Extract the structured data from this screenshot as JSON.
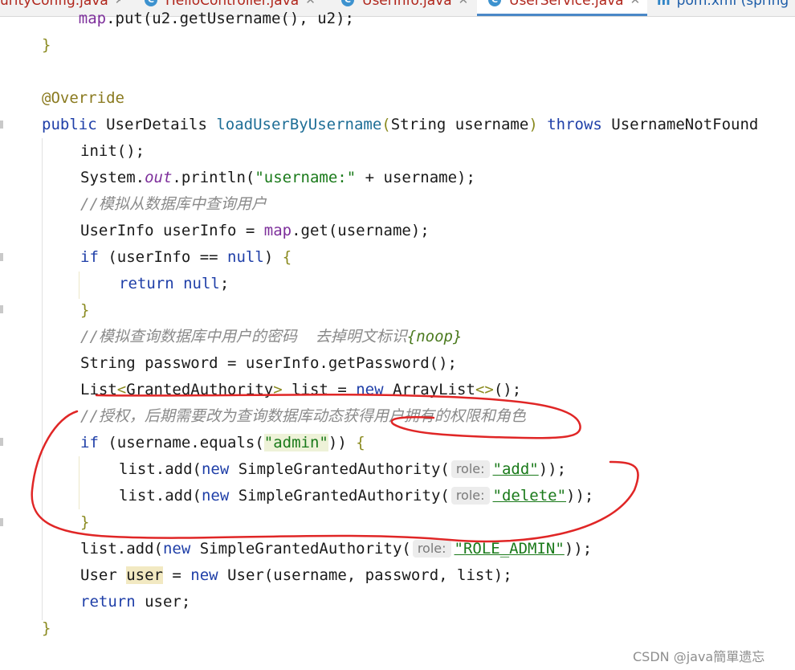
{
  "tabs": [
    {
      "label": "urityConfig.java",
      "icon": "none"
    },
    {
      "label": "HelloController.java",
      "icon": "class-icon"
    },
    {
      "label": "UserInfo.java",
      "icon": "class-icon"
    },
    {
      "label": "UserService.java",
      "icon": "class-icon",
      "active": true
    },
    {
      "label": "pom.xml (spring",
      "icon": "maven-icon"
    }
  ],
  "tab_icon_letter": "C",
  "tab_maven_glyph": "m",
  "close_glyph": "✕",
  "code": {
    "l0": {
      "a": "    ",
      "b": "map",
      "c": ".put(u2.getUsername(), u2);"
    },
    "l1": "}",
    "l3": "@Override",
    "l4": {
      "k": "public ",
      "t": "UserDetails ",
      "f": "loadUserByUsername",
      "p": "(",
      "a": "String username",
      "q": ")",
      "s": " ",
      "th": "throws",
      "r": " UsernameNotFound"
    },
    "l5": "init();",
    "l6": {
      "a": "System.",
      "b": "out",
      "c": ".println(",
      "d": "\"username:\"",
      "e": " + username);"
    },
    "l7": "//模拟从数据库中查询用户",
    "l8": {
      "a": "UserInfo userInfo = ",
      "b": "map",
      "c": ".get(username);"
    },
    "l9": {
      "k": "if ",
      "a": "(userInfo == ",
      "n": "null",
      "b": ") ",
      "c": "{"
    },
    "l10": {
      "k": "return ",
      "n": "null",
      ";": ";"
    },
    "l11": "}",
    "l12": {
      "a": "//模拟查询数据库中用户的密码  去掉明文标识",
      "b": "{noop}"
    },
    "l13": "String password = userInfo.getPassword();",
    "l14": {
      "a": "List",
      "b": "<",
      "c": "GrantedAuthority",
      "d": ">",
      "e": " list = ",
      "k": "new",
      "f": " ArrayList",
      "g": "<>",
      "h": "();"
    },
    "l15": "//授权，后期需要改为查询数据库动态获得用户拥有的权限和角色",
    "l16": {
      "k": "if ",
      "a": "(username.equals(",
      "s": "\"admin\"",
      "b": ")) ",
      "c": "{"
    },
    "l17": {
      "a": "list.add(",
      "k": "new",
      "b": " SimpleGrantedAuthority(",
      "h": "role:",
      "s": "\"add\"",
      "c": "));"
    },
    "l18": {
      "a": "list.add(",
      "k": "new",
      "b": " SimpleGrantedAuthority(",
      "h": "role:",
      "s": "\"delete\"",
      "c": "));"
    },
    "l19": "}",
    "l20": {
      "a": "list.add(",
      "k": "new",
      "b": " SimpleGrantedAuthority(",
      "h": "role:",
      "s": "\"ROLE_ADMIN\"",
      "c": "));"
    },
    "l21": {
      "a": "User ",
      "u": "user",
      "b": " = ",
      "k": "new",
      "c": " User(username, password, list);"
    },
    "l22": {
      "k": "return ",
      "a": "user;"
    },
    "l23": "}"
  },
  "watermark": "CSDN @java簡單遗忘",
  "colors": {
    "annotation_stroke": "#e02626",
    "keyword": "#1f3fa8",
    "string": "#1a7a1a",
    "comment": "#8a8a8a"
  }
}
